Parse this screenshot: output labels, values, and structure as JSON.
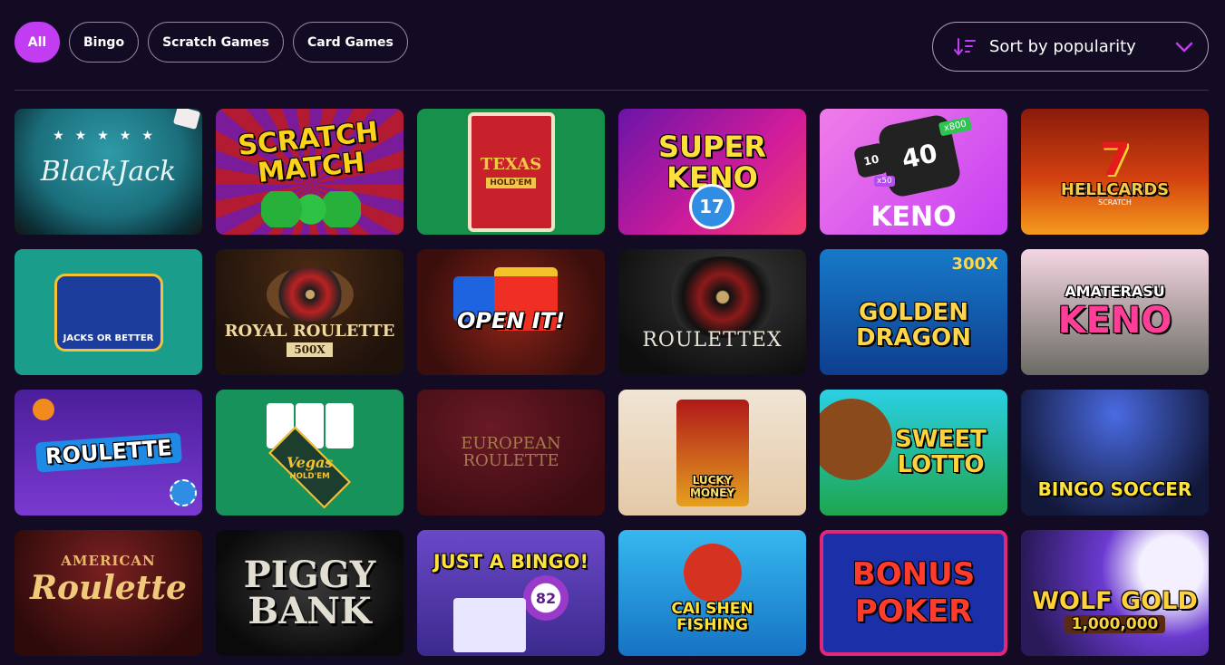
{
  "filters": [
    {
      "label": "All",
      "active": true
    },
    {
      "label": "Bingo",
      "active": false
    },
    {
      "label": "Scratch Games",
      "active": false
    },
    {
      "label": "Card Games",
      "active": false
    }
  ],
  "sort": {
    "label": "Sort by popularity",
    "icon": "sort-icon",
    "chevron": "chevron-down-icon"
  },
  "colors": {
    "background": "#120b23",
    "accent": "#c23cf2"
  },
  "games": [
    {
      "title": "BlackJack"
    },
    {
      "title": "SCRATCH MATCH"
    },
    {
      "title": "TEXAS",
      "sub": "HOLD'EM"
    },
    {
      "title": "SUPER KENO",
      "sub": "17"
    },
    {
      "title": "KENO",
      "sub": "40",
      "badge": "x800",
      "badge2": "10",
      "badge3": "x50"
    },
    {
      "title": "HELLCARDS",
      "sub": "SCRATCH"
    },
    {
      "title": "JACKS OR BETTER"
    },
    {
      "title": "ROYAL ROULETTE",
      "sub": "500X"
    },
    {
      "title": "OPEN IT!"
    },
    {
      "title": "ROULETTEX"
    },
    {
      "title": "GOLDEN DRAGON",
      "sub": "300X"
    },
    {
      "title": "AMATERASU",
      "sub": "KENO"
    },
    {
      "title": "ROULETTE"
    },
    {
      "title": "Vegas",
      "sub": "HOLD'EM"
    },
    {
      "title": "EUROPEAN ROULETTE"
    },
    {
      "title": "LUCKY MONEY"
    },
    {
      "title": "SWEET LOTTO"
    },
    {
      "title": "BINGO SOCCER"
    },
    {
      "title": "AMERICAN",
      "sub": "Roulette"
    },
    {
      "title": "PIGGY BANK"
    },
    {
      "title": "JUST A BINGO!",
      "sub": "82"
    },
    {
      "title": "CAI SHEN FISHING"
    },
    {
      "title": "BONUS POKER"
    },
    {
      "title": "WOLF GOLD",
      "sub": "1,000,000"
    }
  ]
}
